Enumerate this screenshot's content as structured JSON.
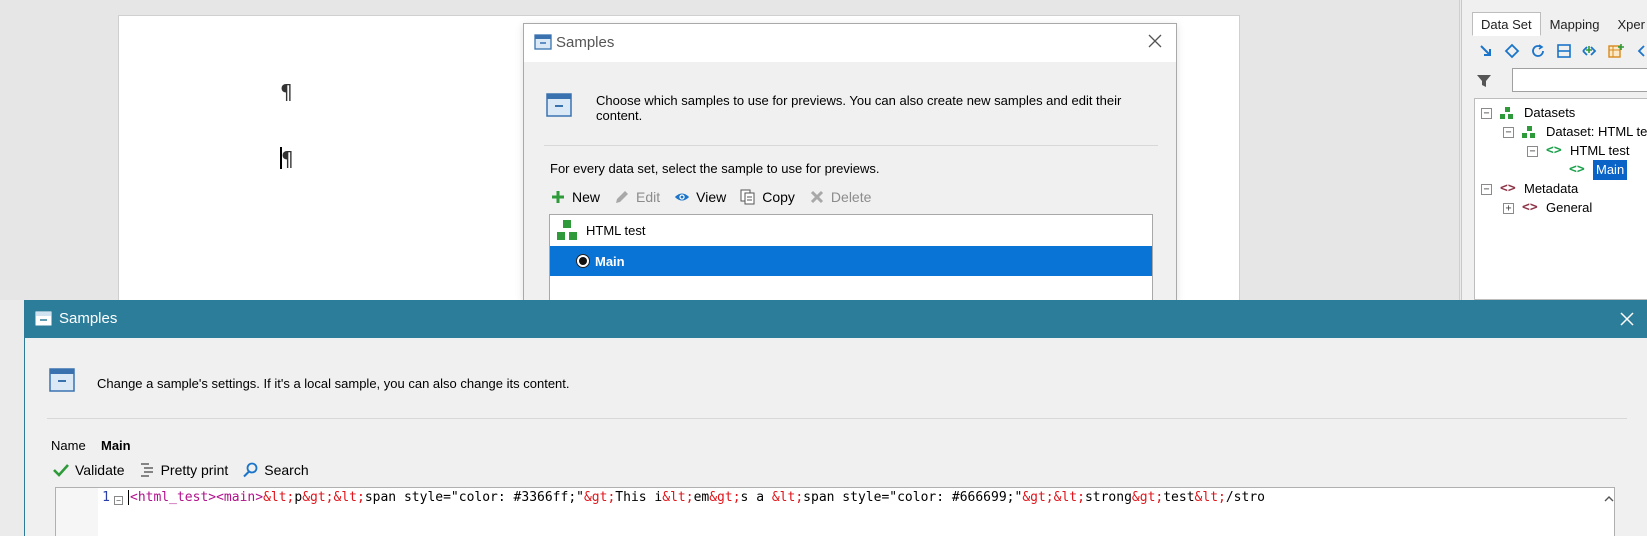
{
  "document": {
    "pilcrow1": "¶",
    "pilcrow2": "¶"
  },
  "right_panel": {
    "tabs": [
      {
        "label": "Data Set",
        "active": true
      },
      {
        "label": "Mapping"
      },
      {
        "label": "Xper"
      }
    ],
    "toolbar_icons": [
      "arrow-icon",
      "diamond-icon",
      "refresh-icon",
      "layout-icon",
      "add-node-icon",
      "table-add-icon",
      "tag-icon"
    ],
    "tree": {
      "datasets": "Datasets",
      "dataset_html": "Dataset: HTML tes",
      "html_test": "HTML test",
      "main": "Main",
      "metadata": "Metadata",
      "general": "General"
    }
  },
  "bg_dialog": {
    "title": "Samples",
    "description": "Choose which samples to use for previews. You can also create new samples and edit their content.",
    "instruction": "For every data set, select the sample to use for previews.",
    "toolbar": {
      "new": "New",
      "edit": "Edit",
      "view": "View",
      "copy": "Copy",
      "delete": "Delete"
    },
    "list": {
      "dataset_row": "HTML test",
      "sample_row": "Main"
    }
  },
  "fg_dialog": {
    "title": "Samples",
    "description": "Change a sample's settings. If it's a local sample, you can also change its content.",
    "name_label": "Name",
    "name_value": "Main",
    "toolbar": {
      "validate": "Validate",
      "pretty_print": "Pretty print",
      "search": "Search"
    },
    "editor": {
      "line_number": "1",
      "code_parts": [
        {
          "t": "tag",
          "s": "<html_test>"
        },
        {
          "t": "tag",
          "s": "<main>"
        },
        {
          "t": "ent",
          "s": "&lt;"
        },
        {
          "t": "txt",
          "s": "p"
        },
        {
          "t": "ent",
          "s": "&gt;&lt;"
        },
        {
          "t": "txt",
          "s": "span style=\"color: #3366ff;\""
        },
        {
          "t": "ent",
          "s": "&gt;"
        },
        {
          "t": "txt",
          "s": "This i"
        },
        {
          "t": "ent",
          "s": "&lt;"
        },
        {
          "t": "txt",
          "s": "em"
        },
        {
          "t": "ent",
          "s": "&gt;"
        },
        {
          "t": "txt",
          "s": "s a "
        },
        {
          "t": "ent",
          "s": "&lt;"
        },
        {
          "t": "txt",
          "s": "span style=\"color: #666699;\""
        },
        {
          "t": "ent",
          "s": "&gt;&lt;"
        },
        {
          "t": "txt",
          "s": "strong"
        },
        {
          "t": "ent",
          "s": "&gt;"
        },
        {
          "t": "txt",
          "s": "test"
        },
        {
          "t": "ent",
          "s": "&lt;"
        },
        {
          "t": "txt",
          "s": "/stro"
        }
      ]
    }
  },
  "colors": {
    "accent_titlebar": "#2c7d9a",
    "selection": "#0a74d6",
    "tag": "#b0118a",
    "entity": "#e0151b"
  }
}
